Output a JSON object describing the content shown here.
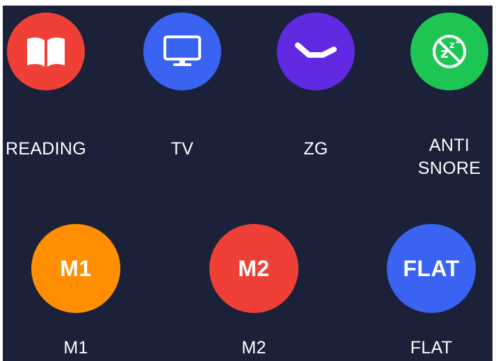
{
  "presets_top": [
    {
      "id": "reading",
      "label": "READING",
      "color": "#ee4036",
      "icon": "open-book-icon"
    },
    {
      "id": "tv",
      "label": "TV",
      "color": "#3a63f2",
      "icon": "tv-monitor-icon"
    },
    {
      "id": "zg",
      "label": "ZG",
      "color": "#6229e3",
      "icon": "zero-gravity-icon"
    },
    {
      "id": "anti-snore",
      "label_line1": "ANTI",
      "label_line2": "SNORE",
      "color": "#1dc552",
      "icon": "no-snore-icon"
    }
  ],
  "presets_bottom": [
    {
      "id": "m1",
      "label": "M1",
      "circle_text": "M1",
      "color": "#ff8f00"
    },
    {
      "id": "m2",
      "label": "M2",
      "circle_text": "M2",
      "color": "#ee4036"
    },
    {
      "id": "flat",
      "label": "FLAT",
      "circle_text": "FLAT",
      "color": "#3a63f2"
    }
  ],
  "anti_snore_icon_text": "Zᶻ"
}
